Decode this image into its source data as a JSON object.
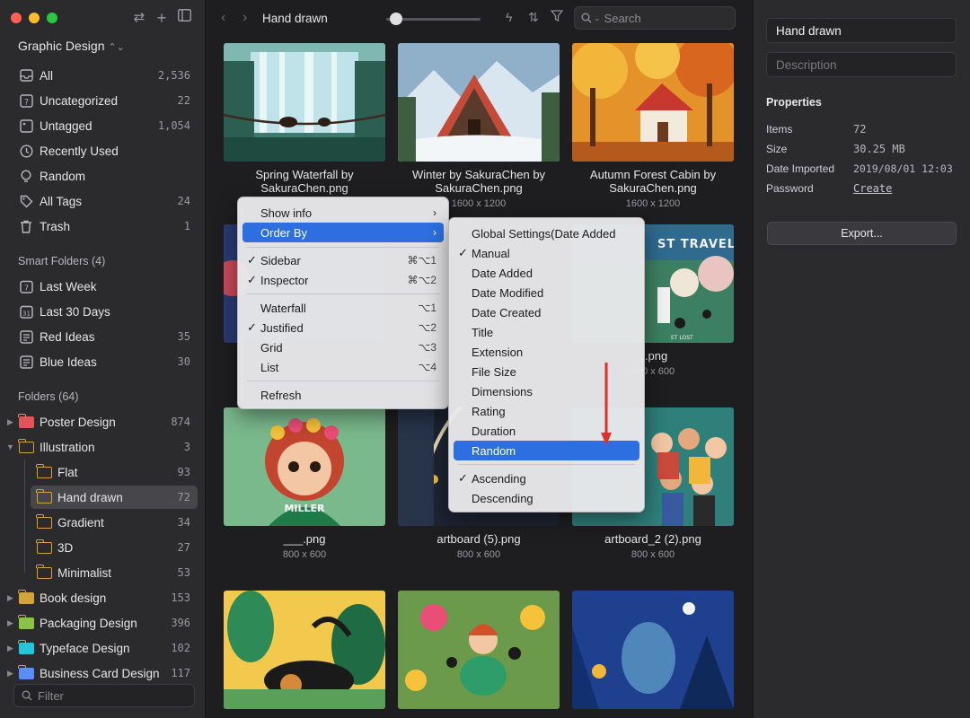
{
  "sidebar": {
    "library": "Graphic Design",
    "items": [
      {
        "label": "All",
        "count": "2,536"
      },
      {
        "label": "Uncategorized",
        "count": "22"
      },
      {
        "label": "Untagged",
        "count": "1,054"
      },
      {
        "label": "Recently Used",
        "count": ""
      },
      {
        "label": "Random",
        "count": ""
      },
      {
        "label": "All Tags",
        "count": "24"
      },
      {
        "label": "Trash",
        "count": "1"
      }
    ],
    "smart_title": "Smart Folders (4)",
    "smart": [
      {
        "label": "Last Week",
        "count": "",
        "day": "7"
      },
      {
        "label": "Last 30 Days",
        "count": "",
        "day": "31"
      },
      {
        "label": "Red Ideas",
        "count": "35"
      },
      {
        "label": "Blue Ideas",
        "count": "30"
      }
    ],
    "folders_title": "Folders (64)",
    "folders": [
      {
        "label": "Poster Design",
        "count": "874"
      },
      {
        "label": "Illustration",
        "count": "3"
      },
      {
        "label": "Flat",
        "count": "93"
      },
      {
        "label": "Hand drawn",
        "count": "72"
      },
      {
        "label": "Gradient",
        "count": "34"
      },
      {
        "label": "3D",
        "count": "27"
      },
      {
        "label": "Minimalist",
        "count": "53"
      },
      {
        "label": "Book design",
        "count": "153"
      },
      {
        "label": "Packaging Design",
        "count": "396"
      },
      {
        "label": "Typeface Design",
        "count": "102"
      },
      {
        "label": "Business Card Design",
        "count": "117"
      }
    ],
    "filter_placeholder": "Filter"
  },
  "toolbar": {
    "title": "Hand drawn",
    "search_placeholder": "Search"
  },
  "grid": [
    {
      "name": "Spring Waterfall by SakuraChen.png",
      "size": ""
    },
    {
      "name": "Winter by SakuraChen by SakuraChen.png",
      "size": "1600 x 1200"
    },
    {
      "name": "Autumn Forest Cabin by SakuraChen.png",
      "size": "1600 x 1200"
    },
    {
      "name": "___.png",
      "size": "800 x 600"
    },
    {
      "name": "artboard (5).png",
      "size": "800 x 600"
    },
    {
      "name": "artboard_2 (2).png",
      "size": "800 x 600"
    },
    {
      "name": "_.png",
      "size": "800 x 600"
    }
  ],
  "inspector": {
    "name": "Hand drawn",
    "description_placeholder": "Description",
    "properties_title": "Properties",
    "props": [
      {
        "key": "Items",
        "value": "72"
      },
      {
        "key": "Size",
        "value": "30.25 MB"
      },
      {
        "key": "Date Imported",
        "value": "2019/08/01 12:03"
      },
      {
        "key": "Password",
        "value": "Create"
      }
    ],
    "export_label": "Export..."
  },
  "context_menu": {
    "show_info": "Show info",
    "order_by": "Order By",
    "sidebar": "Sidebar",
    "sidebar_sc": "⌘⌥1",
    "inspector": "Inspector",
    "inspector_sc": "⌘⌥2",
    "waterfall": "Waterfall",
    "waterfall_sc": "⌥1",
    "justified": "Justified",
    "justified_sc": "⌥2",
    "grid": "Grid",
    "grid_sc": "⌥3",
    "list": "List",
    "list_sc": "⌥4",
    "refresh": "Refresh"
  },
  "submenu": {
    "items": [
      "Global Settings(Date Added",
      "Manual",
      "Date Added",
      "Date Modified",
      "Date Created",
      "Title",
      "Extension",
      "File Size",
      "Dimensions",
      "Rating",
      "Duration",
      "Random"
    ],
    "ascending": "Ascending",
    "descending": "Descending"
  },
  "colors": {
    "accent": "#2d6fe0",
    "folder": "#d4a33a",
    "poster_folder": "#e0555a",
    "packaging_folder": "#8bc34a",
    "typeface_folder": "#26c6da",
    "business_folder": "#5c8df6",
    "annotation_arrow": "#e0302a"
  }
}
